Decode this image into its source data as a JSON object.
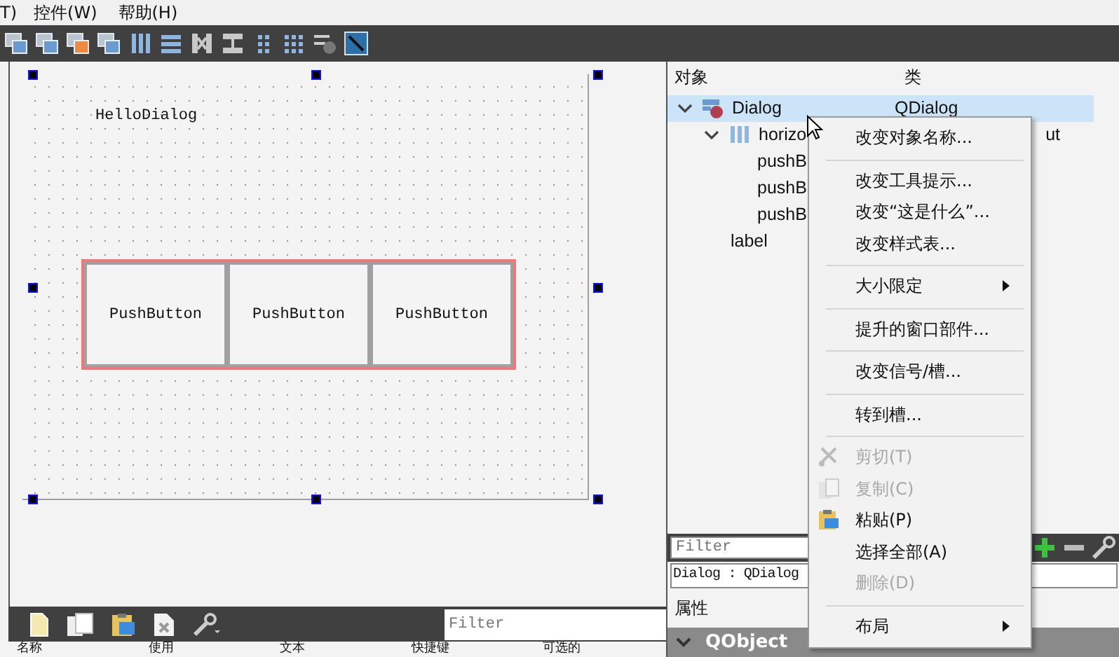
{
  "menubar": [
    {
      "label": "T)"
    },
    {
      "label": "控件(W)"
    },
    {
      "label": "帮助(H)"
    }
  ],
  "form": {
    "label": "HelloDialog",
    "buttons": [
      "PushButton",
      "PushButton",
      "PushButton"
    ]
  },
  "action_editor": {
    "filter_placeholder": "Filter",
    "columns": [
      "名称",
      "使用",
      "文本",
      "快捷键",
      "可选的"
    ]
  },
  "object_inspector": {
    "columns": [
      "对象",
      "类"
    ],
    "tree": [
      {
        "name": "Dialog",
        "class": "QDialog",
        "selected": true,
        "expanded": true,
        "children": [
          {
            "name": "horizo",
            "class": "ut",
            "selected": false,
            "expanded": true,
            "children": [
              {
                "name": "pushB",
                "selected": false
              },
              {
                "name": "pushB",
                "selected": false
              },
              {
                "name": "pushB",
                "selected": false
              }
            ]
          },
          {
            "name": "label",
            "selected": false
          }
        ]
      }
    ]
  },
  "property_editor": {
    "filter_placeholder": "Filter",
    "object": "Dialog : QDialog",
    "title": "属性",
    "group": {
      "name": "QObject",
      "expanded": true
    }
  },
  "context_menu": [
    {
      "kind": "item",
      "label": "改变对象名称...",
      "disabled": false
    },
    {
      "kind": "separator"
    },
    {
      "kind": "item",
      "label": "改变工具提示...",
      "disabled": false
    },
    {
      "kind": "item",
      "label": "改变“这是什么”...",
      "disabled": false
    },
    {
      "kind": "item",
      "label": "改变样式表...",
      "disabled": false
    },
    {
      "kind": "separator"
    },
    {
      "kind": "submenu",
      "label": "大小限定",
      "disabled": false
    },
    {
      "kind": "separator"
    },
    {
      "kind": "item",
      "label": "提升的窗口部件...",
      "disabled": false
    },
    {
      "kind": "separator"
    },
    {
      "kind": "item",
      "label": "改变信号/槽...",
      "disabled": false
    },
    {
      "kind": "separator"
    },
    {
      "kind": "item",
      "label": "转到槽...",
      "disabled": false
    },
    {
      "kind": "separator"
    },
    {
      "kind": "item",
      "label": "剪切(T)",
      "disabled": true
    },
    {
      "kind": "item",
      "label": "复制(C)",
      "disabled": true
    },
    {
      "kind": "item",
      "label": "粘贴(P)",
      "disabled": false
    },
    {
      "kind": "item",
      "label": "选择全部(A)",
      "disabled": false
    },
    {
      "kind": "item",
      "label": "删除(D)",
      "disabled": true
    },
    {
      "kind": "separator"
    },
    {
      "kind": "submenu",
      "label": "布局",
      "disabled": false
    }
  ]
}
